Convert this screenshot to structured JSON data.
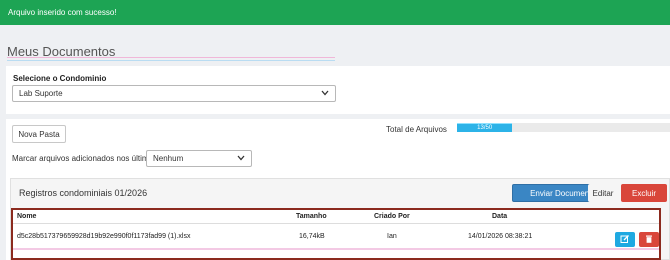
{
  "alert": {
    "message": "Arquivo inserido com sucesso!"
  },
  "page": {
    "title": "Meus Documentos"
  },
  "condominio": {
    "label": "Selecione o Condominio",
    "selected": "Lab Suporte"
  },
  "toolbar": {
    "nova_pasta": "Nova Pasta",
    "total_label": "Total de Arquivos",
    "progress_text": "13/50",
    "progress_fraction": 0.26,
    "marcar_label": "Marcar arquivos adicionados nos últimos:",
    "marcar_selected": "Nenhum"
  },
  "registros": {
    "title": "Registros condominiais 01/2026",
    "enviar": "Enviar Documento",
    "editar": "Editar",
    "excluir": "Excluir"
  },
  "table": {
    "headers": {
      "nome": "Nome",
      "tamanho": "Tamanho",
      "criado_por": "Criado Por",
      "data": "Data"
    },
    "rows": [
      {
        "nome": "d5c28b517379659928d19b92e990f0f1173fad99 (1).xlsx",
        "tamanho": "16,74kB",
        "criado_por": "Ian",
        "data": "14/01/2026 08:38:21"
      }
    ]
  },
  "colors": {
    "alert_bg": "#1da454",
    "primary": "#3a86c4",
    "danger": "#d9463a",
    "info": "#1fa9e1",
    "progress": "#2cb3e8"
  },
  "icons": {
    "edit": "edit-icon",
    "delete": "trash-icon",
    "dropdown": "chevron-down-icon"
  }
}
